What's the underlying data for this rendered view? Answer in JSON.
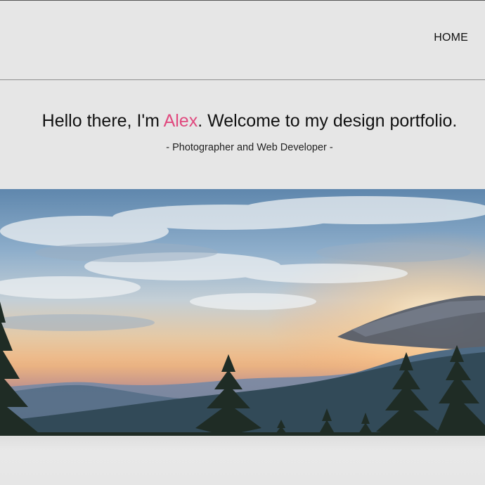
{
  "nav": {
    "home_label": "HOME"
  },
  "hero": {
    "headline_before": "Hello there, I'm ",
    "headline_name": "Alex",
    "headline_after": ". Welcome to my design portfolio.",
    "subtitle": "- Photographer and Web Developer -"
  },
  "banner": {
    "image_name": "mountain-sunset-photo"
  },
  "colors": {
    "accent": "#e0497e",
    "background": "#e6e6e6"
  }
}
